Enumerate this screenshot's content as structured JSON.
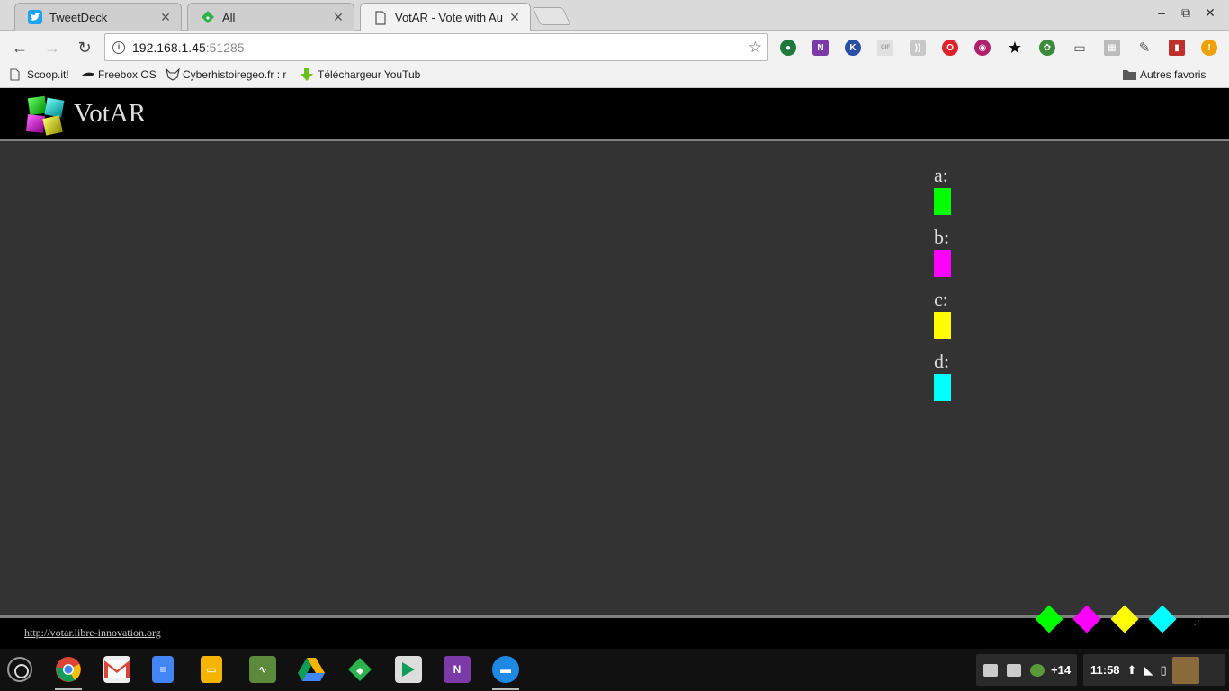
{
  "browser": {
    "tabs": [
      {
        "title": "TweetDeck",
        "icon": "twitter-icon",
        "active": false
      },
      {
        "title": "All",
        "icon": "feedly-icon",
        "active": false
      },
      {
        "title": "VotAR - Vote with Augm",
        "icon": "page-icon",
        "active": true
      }
    ],
    "window_controls": {
      "minimize": "–",
      "restore": "⧉",
      "close": "✕"
    },
    "address": {
      "host": "192.168.1.45",
      "port": ":51285"
    },
    "bookmarks": [
      {
        "label": "Scoop.it!",
        "icon": "page-icon"
      },
      {
        "label": "Freebox OS",
        "icon": "freebox-icon"
      },
      {
        "label": "Cyberhistoiregeo.fr : r",
        "icon": "fox-icon"
      },
      {
        "label": "Téléchargeur YouTub",
        "icon": "download-arrow-icon"
      }
    ],
    "other_bookmarks": "Autres favoris",
    "extensions": [
      "green-ext-icon",
      "onenote-icon",
      "k-icon",
      "gif-icon",
      "rss-icon",
      "opera-icon",
      "record-icon",
      "star-icon",
      "turtle-icon",
      "cast-icon",
      "qr-icon",
      "pen-icon",
      "book-icon",
      "warning-icon"
    ]
  },
  "page": {
    "brand": "VotAR",
    "legend": [
      {
        "label": "a:",
        "color": "#00ff00"
      },
      {
        "label": "b:",
        "color": "#ff00ff"
      },
      {
        "label": "c:",
        "color": "#ffff00"
      },
      {
        "label": "d:",
        "color": "#00ffff"
      }
    ],
    "footer_link": "http://votar.libre-innovation.org"
  },
  "shelf": {
    "apps": [
      "chrome-icon",
      "gmail-icon",
      "docs-icon",
      "slides-icon",
      "app-green-icon",
      "drive-icon",
      "feedly-icon",
      "play-store-icon",
      "onenote-icon",
      "files-icon"
    ],
    "tray_badge": "+14",
    "clock": "11:58"
  },
  "colors": {
    "accent_green": "#00ff00",
    "accent_magenta": "#ff00ff",
    "accent_yellow": "#ffff00",
    "accent_cyan": "#00ffff"
  }
}
